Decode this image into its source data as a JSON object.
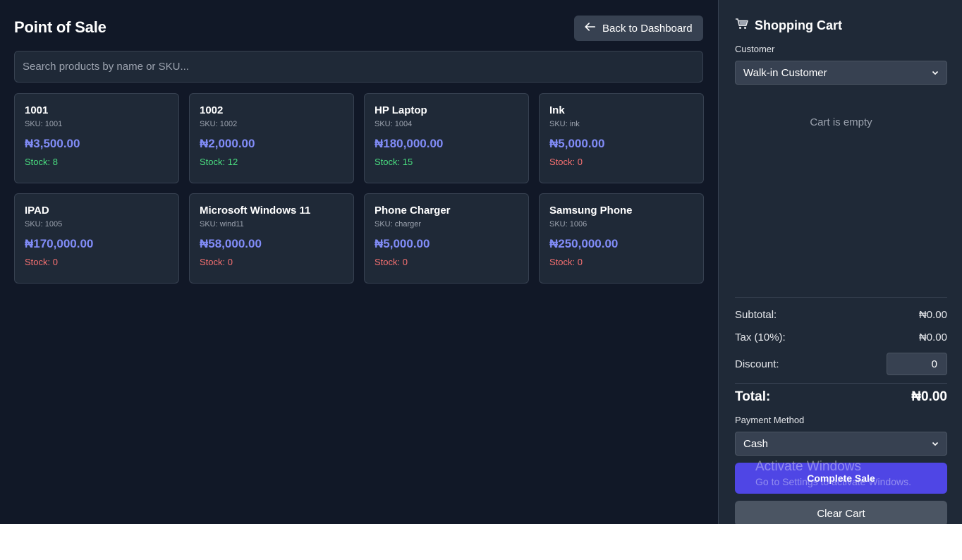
{
  "page": {
    "title": "Point of Sale",
    "back_button_label": "Back to Dashboard",
    "search_placeholder": "Search products by name or SKU..."
  },
  "products": [
    {
      "name": "1001",
      "sku": "SKU: 1001",
      "price": "₦3,500.00",
      "stock": "Stock: 8",
      "in_stock": true
    },
    {
      "name": "1002",
      "sku": "SKU: 1002",
      "price": "₦2,000.00",
      "stock": "Stock: 12",
      "in_stock": true
    },
    {
      "name": "HP Laptop",
      "sku": "SKU: 1004",
      "price": "₦180,000.00",
      "stock": "Stock: 15",
      "in_stock": true
    },
    {
      "name": "Ink",
      "sku": "SKU: ink",
      "price": "₦5,000.00",
      "stock": "Stock: 0",
      "in_stock": false
    },
    {
      "name": "IPAD",
      "sku": "SKU: 1005",
      "price": "₦170,000.00",
      "stock": "Stock: 0",
      "in_stock": false
    },
    {
      "name": "Microsoft Windows 11",
      "sku": "SKU: wind11",
      "price": "₦58,000.00",
      "stock": "Stock: 0",
      "in_stock": false
    },
    {
      "name": "Phone Charger",
      "sku": "SKU: charger",
      "price": "₦5,000.00",
      "stock": "Stock: 0",
      "in_stock": false
    },
    {
      "name": "Samsung Phone",
      "sku": "SKU: 1006",
      "price": "₦250,000.00",
      "stock": "Stock: 0",
      "in_stock": false
    }
  ],
  "cart": {
    "title": "Shopping Cart",
    "customer_label": "Customer",
    "customer_selected": "Walk-in Customer",
    "empty_text": "Cart is empty",
    "subtotal_label": "Subtotal:",
    "subtotal_value": "₦0.00",
    "tax_label": "Tax (10%):",
    "tax_value": "₦0.00",
    "discount_label": "Discount:",
    "discount_value": "0",
    "total_label": "Total:",
    "total_value": "₦0.00",
    "payment_label": "Payment Method",
    "payment_selected": "Cash",
    "complete_label": "Complete Sale",
    "clear_label": "Clear Cart"
  },
  "watermark": {
    "title": "Activate Windows",
    "subtitle": "Go to Settings to activate Windows."
  },
  "colors": {
    "background": "#111827",
    "panel": "#1f2937",
    "accent": "#4f46e5",
    "price": "#818cf8",
    "in_stock": "#4ade80",
    "out_of_stock": "#f87171"
  },
  "icons": {
    "back": "arrow-left-icon",
    "cart": "shopping-cart-icon",
    "dropdown": "chevron-down-icon"
  }
}
